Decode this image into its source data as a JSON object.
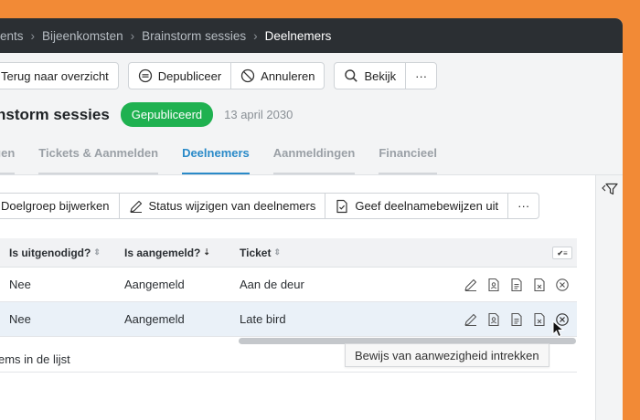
{
  "breadcrumb": {
    "items": [
      "ents",
      "Bijeenkomsten",
      "Brainstorm sessies"
    ],
    "current": "Deelnemers",
    "separator": "›"
  },
  "actions": {
    "back_label": "Terug naar overzicht",
    "unpublish_label": "Depubliceer",
    "cancel_label": "Annuleren",
    "view_label": "Bekijk",
    "more_label": "···"
  },
  "event": {
    "title": "nstorm sessies",
    "status": "Gepubliceerd",
    "date": "13 april 2030"
  },
  "tabs": [
    {
      "label": "lingen"
    },
    {
      "label": "Tickets & Aanmelden"
    },
    {
      "label": "Deelnemers",
      "active": true
    },
    {
      "label": "Aanmeldingen"
    },
    {
      "label": "Financieel"
    }
  ],
  "toolbar": {
    "target_label": "Doelgroep bijwerken",
    "status_label": "Status wijzigen van deelnemers",
    "certificates_label": "Geef deelnamebewijzen uit",
    "more_label": "···"
  },
  "table": {
    "columns": [
      "Is uitgenodigd?",
      "Is aangemeld?",
      "Ticket"
    ],
    "sort_default": "⇕",
    "sort_active": "⇣",
    "column_toggle": "✔≡",
    "rows": [
      {
        "invited": "Nee",
        "registered": "Aangemeld",
        "ticket": "Aan de deur"
      },
      {
        "invited": "Nee",
        "registered": "Aangemeld",
        "ticket": "Late bird"
      }
    ],
    "footer": "ems in de lijst"
  },
  "tooltip": "Bewijs van aanwezigheid intrekken",
  "colors": {
    "accent": "#2a8ac8",
    "published": "#1fb150",
    "background": "#f28a36",
    "topbar": "#2b2f33"
  }
}
